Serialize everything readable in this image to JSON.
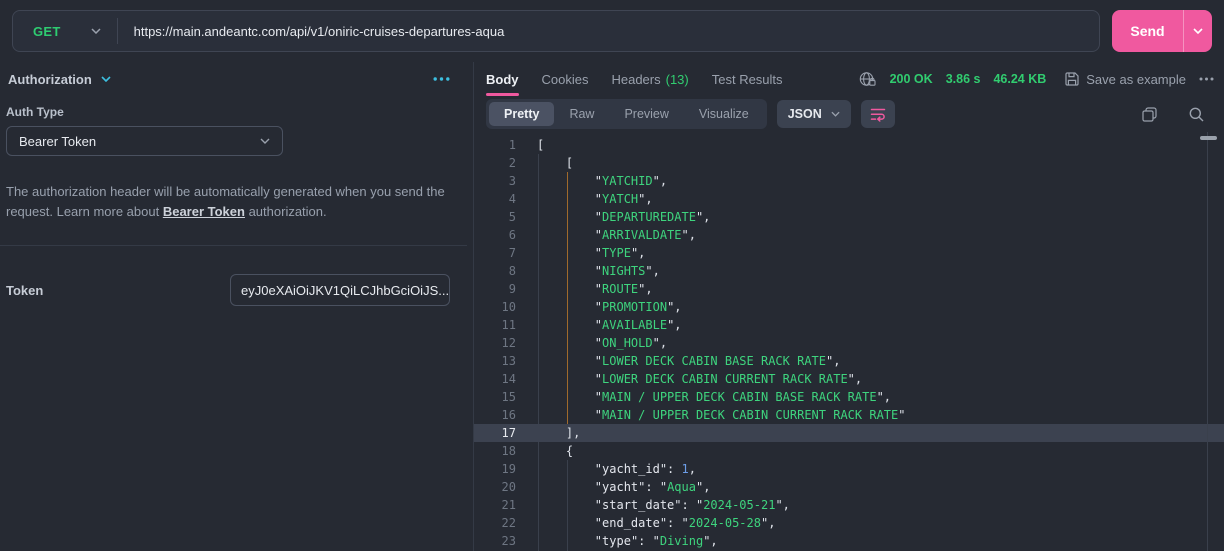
{
  "request": {
    "method": "GET",
    "url": "https://main.andeantc.com/api/v1/oniric-cruises-departures-aqua",
    "send_label": "Send"
  },
  "auth": {
    "title": "Authorization",
    "type_label": "Auth Type",
    "type_value": "Bearer Token",
    "desc_before": "The authorization header will be automatically generated when you send the request. Learn more about ",
    "desc_link": "Bearer Token",
    "desc_after": " authorization.",
    "token_label": "Token",
    "token_value": "eyJ0eXAiOiJKV1QiLCJhbGciOiJS..."
  },
  "response": {
    "tabs": {
      "body": "Body",
      "cookies": "Cookies",
      "headers": "Headers",
      "headers_count": "(13)",
      "tests": "Test Results"
    },
    "status": {
      "code": "200 OK",
      "time": "3.86 s",
      "size": "46.24 KB"
    },
    "save_example": "Save as example",
    "views": {
      "pretty": "Pretty",
      "raw": "Raw",
      "preview": "Preview",
      "visualize": "Visualize"
    },
    "active_view": "Pretty",
    "format": "JSON",
    "code": {
      "lines": [
        {
          "n": 1,
          "ind": 0,
          "toks": [
            [
              "p",
              "["
            ]
          ]
        },
        {
          "n": 2,
          "ind": 1,
          "toks": [
            [
              "p",
              "["
            ]
          ]
        },
        {
          "n": 3,
          "ind": 2,
          "toks": [
            [
              "p",
              "\""
            ],
            [
              "s",
              "YATCHID"
            ],
            [
              "p",
              "\","
            ]
          ]
        },
        {
          "n": 4,
          "ind": 2,
          "toks": [
            [
              "p",
              "\""
            ],
            [
              "s",
              "YATCH"
            ],
            [
              "p",
              "\","
            ]
          ]
        },
        {
          "n": 5,
          "ind": 2,
          "toks": [
            [
              "p",
              "\""
            ],
            [
              "s",
              "DEPARTUREDATE"
            ],
            [
              "p",
              "\","
            ]
          ]
        },
        {
          "n": 6,
          "ind": 2,
          "toks": [
            [
              "p",
              "\""
            ],
            [
              "s",
              "ARRIVALDATE"
            ],
            [
              "p",
              "\","
            ]
          ]
        },
        {
          "n": 7,
          "ind": 2,
          "toks": [
            [
              "p",
              "\""
            ],
            [
              "s",
              "TYPE"
            ],
            [
              "p",
              "\","
            ]
          ]
        },
        {
          "n": 8,
          "ind": 2,
          "toks": [
            [
              "p",
              "\""
            ],
            [
              "s",
              "NIGHTS"
            ],
            [
              "p",
              "\","
            ]
          ]
        },
        {
          "n": 9,
          "ind": 2,
          "toks": [
            [
              "p",
              "\""
            ],
            [
              "s",
              "ROUTE"
            ],
            [
              "p",
              "\","
            ]
          ]
        },
        {
          "n": 10,
          "ind": 2,
          "toks": [
            [
              "p",
              "\""
            ],
            [
              "s",
              "PROMOTION"
            ],
            [
              "p",
              "\","
            ]
          ]
        },
        {
          "n": 11,
          "ind": 2,
          "toks": [
            [
              "p",
              "\""
            ],
            [
              "s",
              "AVAILABLE"
            ],
            [
              "p",
              "\","
            ]
          ]
        },
        {
          "n": 12,
          "ind": 2,
          "toks": [
            [
              "p",
              "\""
            ],
            [
              "s",
              "ON_HOLD"
            ],
            [
              "p",
              "\","
            ]
          ]
        },
        {
          "n": 13,
          "ind": 2,
          "toks": [
            [
              "p",
              "\""
            ],
            [
              "s",
              "LOWER DECK CABIN BASE RACK RATE"
            ],
            [
              "p",
              "\","
            ]
          ]
        },
        {
          "n": 14,
          "ind": 2,
          "toks": [
            [
              "p",
              "\""
            ],
            [
              "s",
              "LOWER DECK CABIN CURRENT RACK RATE"
            ],
            [
              "p",
              "\","
            ]
          ]
        },
        {
          "n": 15,
          "ind": 2,
          "toks": [
            [
              "p",
              "\""
            ],
            [
              "s",
              "MAIN / UPPER DECK CABIN BASE RACK RATE"
            ],
            [
              "p",
              "\","
            ]
          ]
        },
        {
          "n": 16,
          "ind": 2,
          "toks": [
            [
              "p",
              "\""
            ],
            [
              "s",
              "MAIN / UPPER DECK CABIN CURRENT RACK RATE"
            ],
            [
              "p",
              "\""
            ]
          ]
        },
        {
          "n": 17,
          "ind": 1,
          "hl": true,
          "toks": [
            [
              "p",
              "],"
            ]
          ]
        },
        {
          "n": 18,
          "ind": 1,
          "toks": [
            [
              "p",
              "{"
            ]
          ]
        },
        {
          "n": 19,
          "ind": 2,
          "toks": [
            [
              "p",
              "\""
            ],
            [
              "k",
              "yacht_id"
            ],
            [
              "p",
              "\": "
            ],
            [
              "num",
              "1"
            ],
            [
              "p",
              ","
            ]
          ]
        },
        {
          "n": 20,
          "ind": 2,
          "toks": [
            [
              "p",
              "\""
            ],
            [
              "k",
              "yacht"
            ],
            [
              "p",
              "\": \""
            ],
            [
              "s",
              "Aqua"
            ],
            [
              "p",
              "\","
            ]
          ]
        },
        {
          "n": 21,
          "ind": 2,
          "toks": [
            [
              "p",
              "\""
            ],
            [
              "k",
              "start_date"
            ],
            [
              "p",
              "\": \""
            ],
            [
              "s",
              "2024-05-21"
            ],
            [
              "p",
              "\","
            ]
          ]
        },
        {
          "n": 22,
          "ind": 2,
          "toks": [
            [
              "p",
              "\""
            ],
            [
              "k",
              "end_date"
            ],
            [
              "p",
              "\": \""
            ],
            [
              "s",
              "2024-05-28"
            ],
            [
              "p",
              "\","
            ]
          ]
        },
        {
          "n": 23,
          "ind": 2,
          "toks": [
            [
              "p",
              "\""
            ],
            [
              "k",
              "type"
            ],
            [
              "p",
              "\": \""
            ],
            [
              "s",
              "Diving"
            ],
            [
              "p",
              "\","
            ]
          ]
        }
      ]
    }
  },
  "colors": {
    "accent_pink": "#f0599f",
    "ui_green": "#2ecc71",
    "status_green": "#31cd70",
    "cyan": "#3cbfe0",
    "code_string_green": "#3ed47e",
    "code_number_blue": "#6d9ee8",
    "indent_guide_active": "#a06a2c"
  }
}
